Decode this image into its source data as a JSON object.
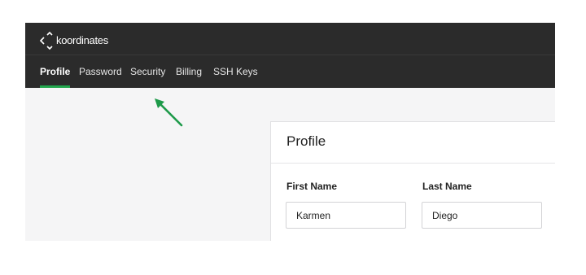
{
  "brand": {
    "name": "koordinates"
  },
  "nav": {
    "tabs": [
      {
        "label": "Profile",
        "active": true
      },
      {
        "label": "Password",
        "active": false
      },
      {
        "label": "Security",
        "active": false
      },
      {
        "label": "Billing",
        "active": false
      },
      {
        "label": "SSH Keys",
        "active": false
      }
    ]
  },
  "profile": {
    "title": "Profile",
    "first_name": {
      "label": "First Name",
      "value": "Karmen"
    },
    "last_name": {
      "label": "Last Name",
      "value": "Diego"
    }
  },
  "colors": {
    "topbar": "#2b2b2b",
    "accent": "#22a64d",
    "annotation_arrow": "#1e9a4a",
    "page_background": "#f5f5f6"
  },
  "icons": {
    "logo": "koordinates-logo-icon",
    "annotation": "annotation-arrow-icon"
  }
}
